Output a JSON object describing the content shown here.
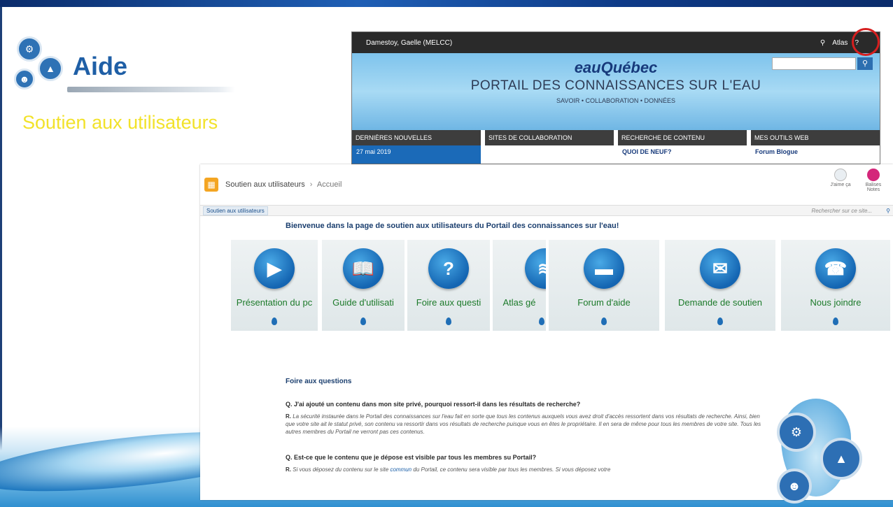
{
  "slide": {
    "title": "Aide",
    "subtitle": "Soutien aux utilisateurs"
  },
  "portal": {
    "user": "Damestoy, Gaelle (MELCC)",
    "atlas": "Atlas",
    "help": "?",
    "brand": "eauQuébec",
    "title": "PORTAIL DES CONNAISSANCES SUR L'EAU",
    "tagline": "SAVOIR • COLLABORATION • DONNÉES",
    "columns": [
      {
        "head": "DERNIÈRES NOUVELLES",
        "body": "27 mai 2019"
      },
      {
        "head": "SITES DE COLLABORATION",
        "body": ""
      },
      {
        "head": "RECHERCHE DE CONTENU",
        "body": "QUOI DE NEUF?"
      },
      {
        "head": "MES OUTILS WEB",
        "body": "Forum   Blogue"
      }
    ]
  },
  "support": {
    "site_name": "Soutien aux utilisateurs",
    "breadcrumb_sep": "›",
    "breadcrumb_current": "Accueil",
    "like_label": "J'aime ça",
    "notes_label": "Balises Notes",
    "nav_tab": "Soutien aux utilisateurs",
    "search_placeholder": "Rechercher sur ce site...",
    "welcome": "Bienvenue dans la page de soutien aux utilisateurs du Portail des connaissances sur l'eau!",
    "tiles": [
      {
        "label": "Présentation du pc",
        "icon": "video-camera-icon",
        "glyph": "▶"
      },
      {
        "label": "Guide d'utilisati",
        "icon": "book-icon",
        "glyph": "📖"
      },
      {
        "label": "Foire aux questi",
        "icon": "question-icon",
        "glyph": "?"
      },
      {
        "label": "Atlas gé",
        "icon": "atlas-icon",
        "glyph": "≋"
      },
      {
        "label": "Forum d'aide",
        "icon": "speech-bubble-icon",
        "glyph": "▬"
      },
      {
        "label": "Demande de soutien",
        "icon": "envelope-icon",
        "glyph": "✉"
      },
      {
        "label": "Nous joindre",
        "icon": "telephone-icon",
        "glyph": "☎"
      }
    ],
    "faq": {
      "title": "Foire aux questions",
      "q1": "Q. J'ai ajouté un contenu dans mon site privé, pourquoi ressort-il dans les résultats de recherche?",
      "a1_prefix": "R.",
      "a1": "La sécurité instaurée dans le Portail des connaissances sur l'eau fait en sorte que tous les contenus auxquels vous avez droit d'accès ressortent dans vos résultats de recherche. Ainsi, bien que votre site ait le statut privé, son contenu va ressortir dans vos résultats de recherche puisque vous en êtes le propriétaire. Il en sera de même pour tous les membres de votre site. Tous les autres membres du Portail ne verront pas ces contenus.",
      "q2": "Q. Est-ce que le contenu que je dépose est visible par tous les membres su Portail?",
      "a2_prefix": "R.",
      "a2_start": "Si vous déposez du contenu sur le site",
      "a2_link": "commun",
      "a2_end": "du Portail, ce contenu sera visible par tous les membres. Si vous déposez votre"
    }
  },
  "colors": {
    "title_blue": "#1f5fa6",
    "subtitle_yellow": "#f2e22a",
    "tile_label_green": "#1c7a2a",
    "help_circle_red": "#d61f1f"
  }
}
